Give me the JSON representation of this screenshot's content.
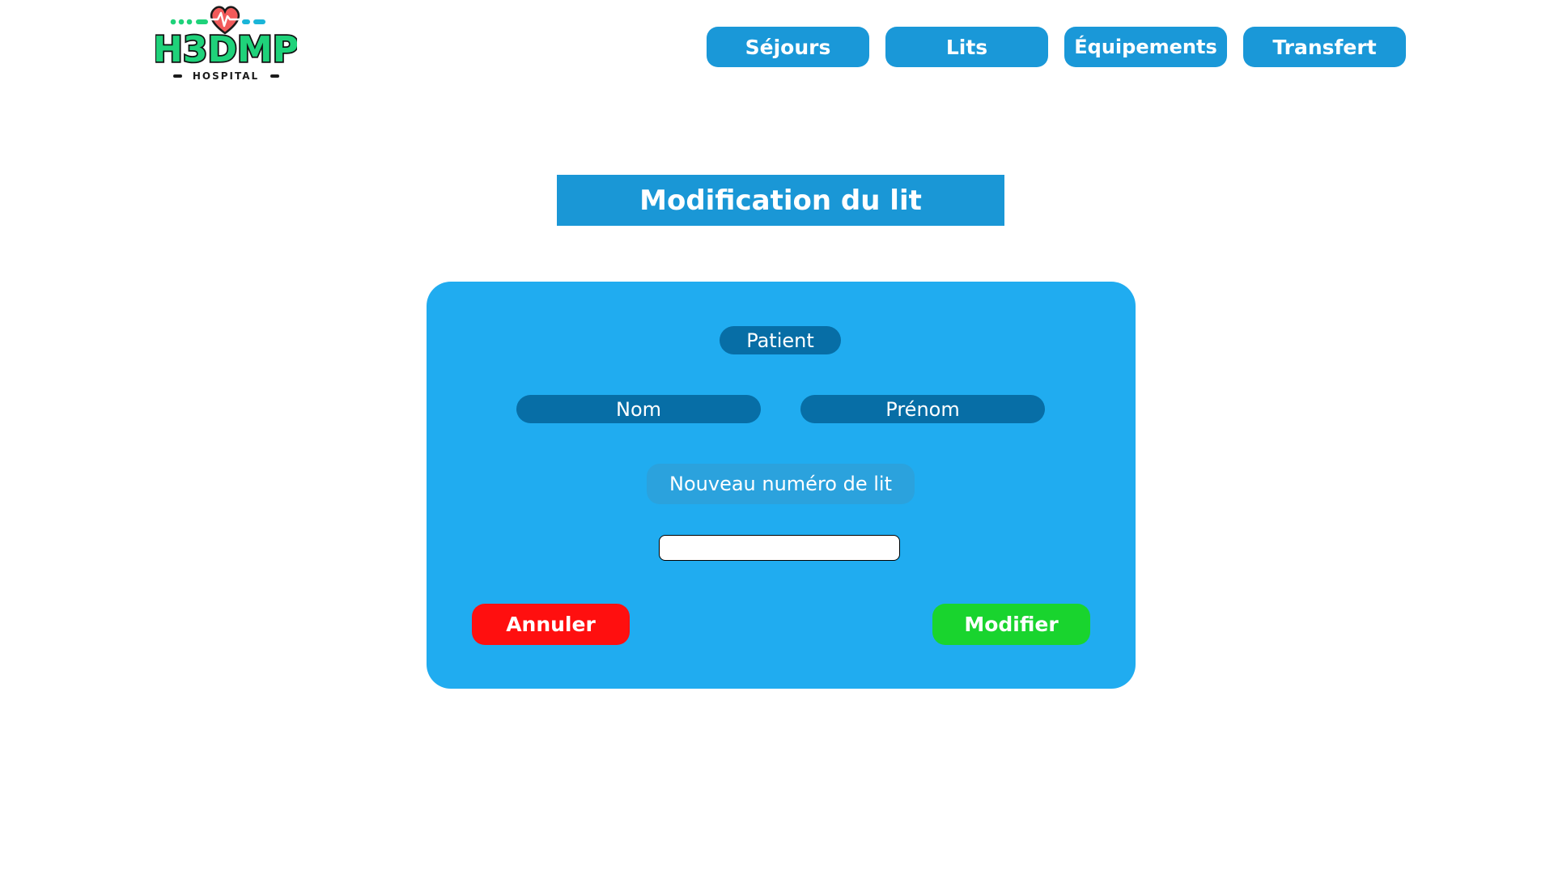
{
  "logo": {
    "main_text": "H3DMP",
    "sub_text": "HOSPITAL",
    "icon": "heart-pulse-icon",
    "colors": [
      "#1fd27a",
      "#1aa7e8",
      "#f25a5a"
    ]
  },
  "nav": {
    "items": [
      {
        "label": "Séjours"
      },
      {
        "label": "Lits"
      },
      {
        "label": "Équipements"
      },
      {
        "label": "Transfert"
      }
    ],
    "color": "#1a98d8"
  },
  "page": {
    "title": "Modification du lit"
  },
  "form": {
    "section_label": "Patient",
    "nom_label": "Nom",
    "prenom_label": "Prénom",
    "bed_label": "Nouveau numéro de lit",
    "bed_value": "",
    "cancel_label": "Annuler",
    "submit_label": "Modifier",
    "card_color": "#20acf0",
    "cancel_color": "#ff0f0f",
    "submit_color": "#19d42e"
  }
}
